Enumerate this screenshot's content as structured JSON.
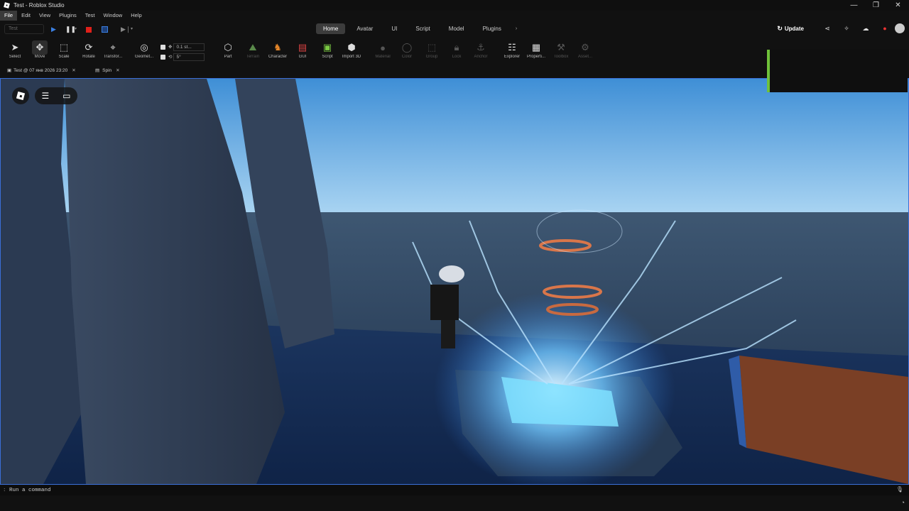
{
  "window": {
    "title": "Test - Roblox Studio",
    "controls": [
      "—",
      "❐",
      "✕"
    ]
  },
  "menu": [
    "File",
    "Edit",
    "View",
    "Plugins",
    "Test",
    "Window",
    "Help"
  ],
  "topbar": {
    "test_dropdown": "Test",
    "tabs": [
      "Home",
      "Avatar",
      "UI",
      "Script",
      "Model",
      "Plugins"
    ],
    "active_tab": "Home",
    "update_label": "Update"
  },
  "ribbon": {
    "select": "Select",
    "move": "Move",
    "scale": "Scale",
    "rotate": "Rotate",
    "transform": "Transfor...",
    "geometry": "Geomet...",
    "move_snap": "0.1 st...",
    "rotate_snap": "5°",
    "part": "Part",
    "terrain": "Terrain",
    "character": "Character",
    "gui": "GUI",
    "script": "Script",
    "import3d": "Import 3D",
    "material": "Material",
    "color": "Color",
    "group": "Group",
    "lock": "Lock",
    "anchor": "Anchor",
    "explorer": "Explorer",
    "properties": "Properti...",
    "toolbox": "Toolbox",
    "assets": "Asset..."
  },
  "doc_tabs": [
    {
      "label": "Test @ 07 янв 2026 23:20"
    },
    {
      "label": "Spin"
    }
  ],
  "command_bar": {
    "placeholder": "Run a command"
  },
  "colors": {
    "accent_green": "#6fc13a",
    "viewport_border": "#3a6fd8",
    "stop_red": "#e0201a",
    "play_blue": "#3b7fe0"
  }
}
